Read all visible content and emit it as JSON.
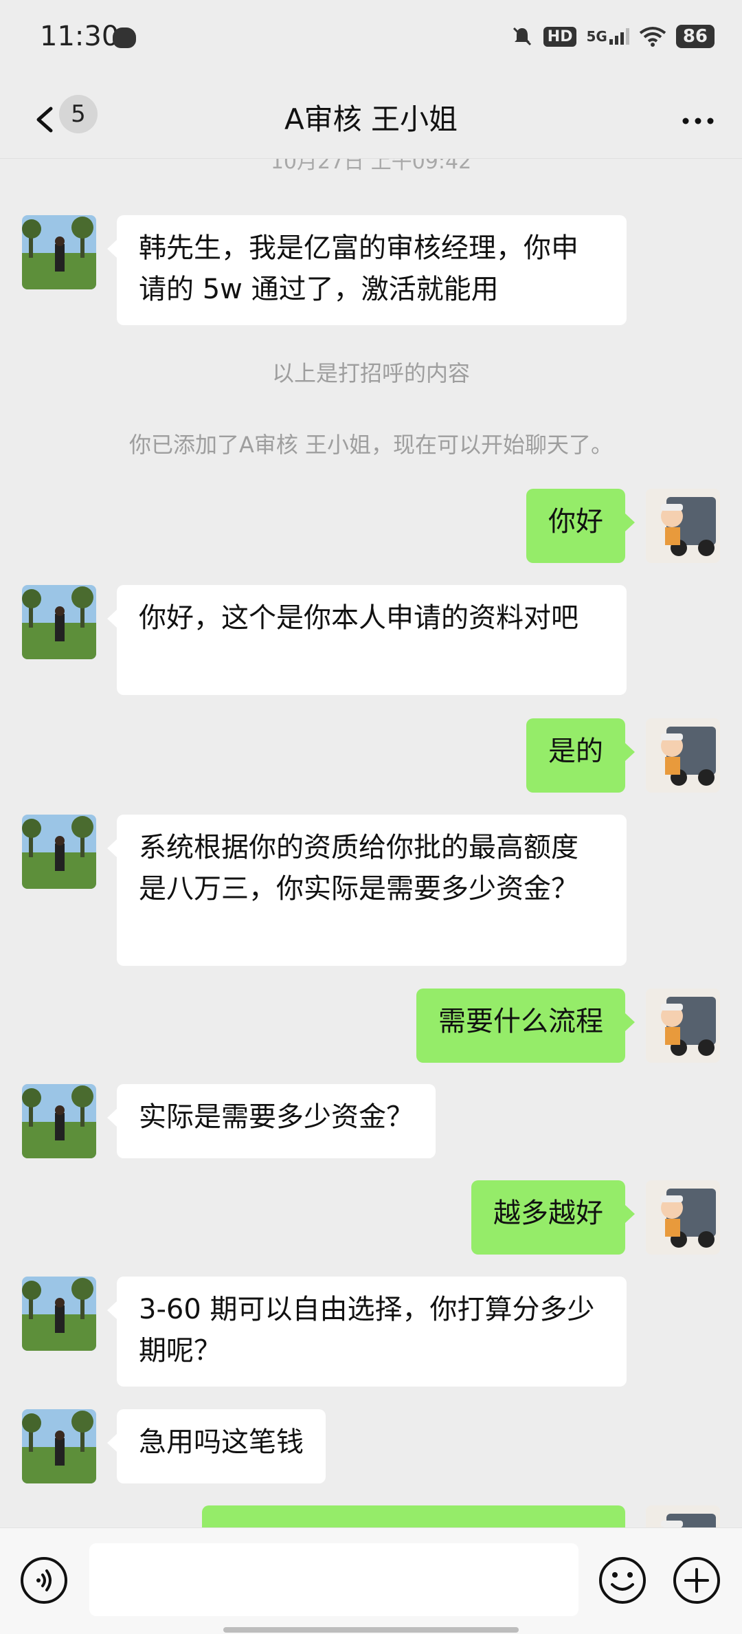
{
  "status_bar": {
    "time": "11:30",
    "hd": "HD",
    "network": "5G",
    "battery": "86"
  },
  "nav": {
    "unread_count": "5",
    "title": "A审核 王小姐"
  },
  "partial_timestamp": "10月27日 上午09:42",
  "messages": {
    "m1": "韩先生，我是亿富的审核经理，你申请的 5w 通过了，激活就能用",
    "sys1": "以上是打招呼的内容",
    "sys2": "你已添加了A审核 王小姐，现在可以开始聊天了。",
    "m2": "你好",
    "m3": "你好，这个是你本人申请的资料对吧",
    "m4": "是的",
    "m5": "系统根据你的资质给你批的最高额度是八万三，你实际是需要多少资金？",
    "m6": "需要什么流程",
    "m7": "实际是需要多少资金？",
    "m8": "越多越好",
    "m9": "3-60 期可以自由选择，你打算分多少期呢？",
    "m10": "急用吗这笔钱"
  },
  "colors": {
    "background": "#ededed",
    "sent_bubble": "#95ec69",
    "received_bubble": "#ffffff"
  },
  "icons": {
    "back": "chevron-left-icon",
    "more": "more-icon",
    "voice": "voice-icon",
    "emoji": "emoji-icon",
    "plus": "plus-icon"
  }
}
